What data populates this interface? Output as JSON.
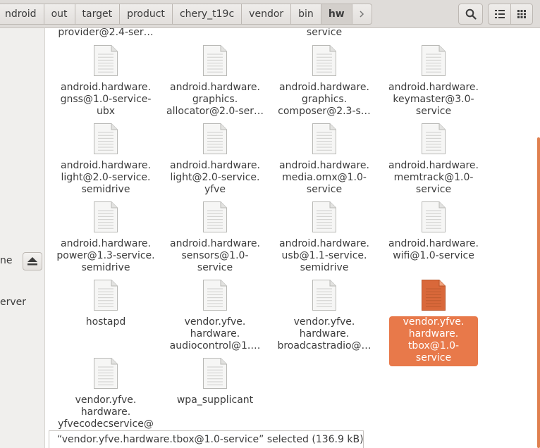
{
  "breadcrumbs": [
    "ndroid",
    "out",
    "target",
    "product",
    "chery_t19c",
    "vendor",
    "bin",
    "hw"
  ],
  "header": {
    "forward_icon": "chevron-right-icon",
    "search_icon": "search-icon",
    "list_view_icon": "list-view-icon",
    "grid_view_icon": "grid-view-icon"
  },
  "sidebar": {
    "partial_item_1": "ne",
    "partial_item_2": "erver",
    "eject_icon": "eject-icon"
  },
  "partial_top_row": [
    "provider@2.4-ser…",
    "service"
  ],
  "files": [
    {
      "label": "android.hardware.\ngnss@1.0-service-\nubx"
    },
    {
      "label": "android.hardware.\ngraphics.\nallocator@2.0-ser…"
    },
    {
      "label": "android.hardware.\ngraphics.\ncomposer@2.3-s…"
    },
    {
      "label": "android.hardware.\nkeymaster@3.0-\nservice"
    },
    {
      "label": "android.hardware.\nlight@2.0-service.\nsemidrive"
    },
    {
      "label": "android.hardware.\nlight@2.0-service.\nyfve"
    },
    {
      "label": "android.hardware.\nmedia.omx@1.0-\nservice"
    },
    {
      "label": "android.hardware.\nmemtrack@1.0-\nservice"
    },
    {
      "label": "android.hardware.\npower@1.3-service.\nsemidrive"
    },
    {
      "label": "android.hardware.\nsensors@1.0-\nservice"
    },
    {
      "label": "android.hardware.\nusb@1.1-service.\nsemidrive"
    },
    {
      "label": "android.hardware.\nwifi@1.0-service"
    },
    {
      "label": "hostapd"
    },
    {
      "label": "vendor.yfve.\nhardware.\naudiocontrol@1.…"
    },
    {
      "label": "vendor.yfve.\nhardware.\nbroadcastradio@…"
    },
    {
      "label": "vendor.yfve.\nhardware.\ntbox@1.0-service",
      "selected": true
    },
    {
      "label": "vendor.yfve.\nhardware.\nyfvecodecservice@"
    },
    {
      "label": "wpa_supplicant"
    }
  ],
  "status": {
    "text": "“vendor.yfve.hardware.tbox@1.0-service” selected  (136.9 kB)"
  },
  "colors": {
    "selection": "#e8794a",
    "selected_icon": "#d9683a",
    "header_bg": "#dfdcd9"
  }
}
